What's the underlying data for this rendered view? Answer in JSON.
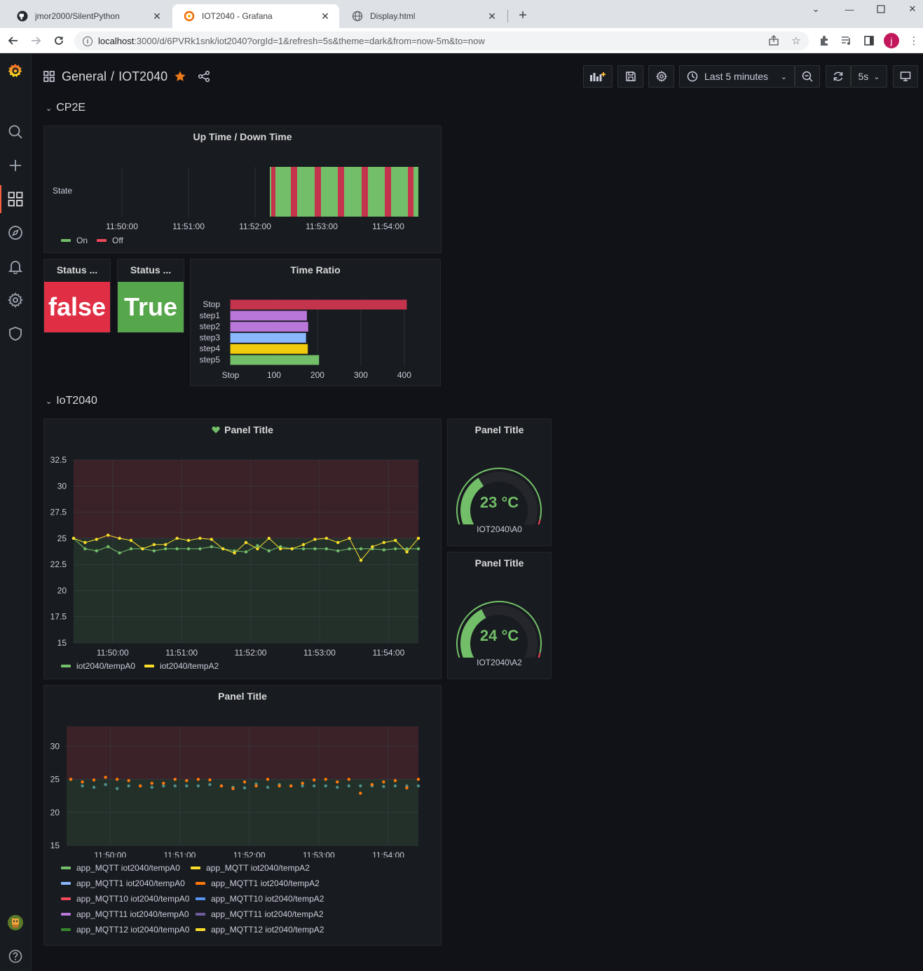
{
  "browser": {
    "tabs": [
      {
        "title": "jmor2000/SilentPython",
        "icon": "github-icon",
        "active": false
      },
      {
        "title": "IOT2040 - Grafana",
        "icon": "grafana-icon",
        "active": true
      },
      {
        "title": "Display.html",
        "icon": "globe-icon",
        "active": false
      }
    ],
    "url_host": "localhost",
    "url_rest": ":3000/d/6PVRk1snk/iot2040?orgId=1&refresh=5s&theme=dark&from=now-5m&to=now",
    "profile_initial": "j"
  },
  "header": {
    "folder": "General",
    "separator": "/",
    "dashboard": "IOT2040",
    "time_range": "Last 5 minutes",
    "refresh": "5s"
  },
  "rows": {
    "cp2e": "CP2E",
    "iot2040": "IoT2040"
  },
  "colors": {
    "green": "#73bf69",
    "red": "#c4344d",
    "yellow": "#fade2a",
    "orange": "#ff780a",
    "stat_red": "#e02f44",
    "stat_green": "#56a64b"
  },
  "panels": {
    "uptime": {
      "title": "Up Time / Down Time",
      "row_label": "State",
      "ticks": [
        "11:50:00",
        "11:51:00",
        "11:52:00",
        "11:53:00",
        "11:54:00"
      ],
      "legend": [
        {
          "name": "On",
          "color": "#73bf69"
        },
        {
          "name": "Off",
          "color": "#f2495c"
        }
      ]
    },
    "status1": {
      "title": "Status ...",
      "value": "false"
    },
    "status2": {
      "title": "Status ...",
      "value": "True"
    },
    "time_ratio": {
      "title": "Time Ratio"
    },
    "temp_panel": {
      "title": "Panel Title",
      "yticks": [
        "32.5",
        "30",
        "27.5",
        "25",
        "22.5",
        "20",
        "17.5",
        "15"
      ],
      "xticks": [
        "11:50:00",
        "11:51:00",
        "11:52:00",
        "11:53:00",
        "11:54:00"
      ],
      "legend": [
        {
          "name": "iot2040/tempA0",
          "color": "#73bf69"
        },
        {
          "name": "iot2040/tempA2",
          "color": "#fade2a"
        }
      ]
    },
    "gauge_a0": {
      "title": "Panel Title",
      "value": "23 °C",
      "label": "IOT2040\\A0",
      "fraction": 0.38
    },
    "gauge_a2": {
      "title": "Panel Title",
      "value": "24 °C",
      "label": "IOT2040\\A2",
      "fraction": 0.4
    },
    "mqtt_panel": {
      "title": "Panel Title",
      "yticks": [
        "30",
        "25",
        "20",
        "15"
      ],
      "xticks": [
        "11:50:00",
        "11:51:00",
        "11:52:00",
        "11:53:00",
        "11:54:00"
      ],
      "legend": [
        {
          "name": "app_MQTT iot2040/tempA0",
          "color": "#73bf69"
        },
        {
          "name": "app_MQTT iot2040/tempA2",
          "color": "#fade2a"
        },
        {
          "name": "app_MQTT1 iot2040/tempA0",
          "color": "#8ab8ff"
        },
        {
          "name": "app_MQTT1 iot2040/tempA2",
          "color": "#ff780a"
        },
        {
          "name": "app_MQTT10 iot2040/tempA0",
          "color": "#f2495c"
        },
        {
          "name": "app_MQTT10 iot2040/tempA2",
          "color": "#5794f2"
        },
        {
          "name": "app_MQTT11 iot2040/tempA0",
          "color": "#b877d9"
        },
        {
          "name": "app_MQTT11 iot2040/tempA2",
          "color": "#705da0"
        },
        {
          "name": "app_MQTT12 iot2040/tempA0",
          "color": "#37872d"
        },
        {
          "name": "app_MQTT12 iot2040/tempA2",
          "color": "#fade2a"
        }
      ]
    }
  },
  "chart_data": [
    {
      "type": "bar",
      "title": "Time Ratio",
      "orientation": "horizontal",
      "categories": [
        "Stop",
        "step1",
        "step2",
        "step3",
        "step4",
        "step5"
      ],
      "values": [
        405,
        175,
        178,
        173,
        177,
        203
      ],
      "colors": [
        "#c4344d",
        "#b877d9",
        "#b877d9",
        "#8ab8ff",
        "#f2cc0c",
        "#73bf69"
      ],
      "xticks": [
        "Stop",
        "100",
        "200",
        "300",
        "400"
      ],
      "xlim": [
        0,
        420
      ]
    },
    {
      "type": "line",
      "title": "Panel Title",
      "ylim": [
        15,
        32.5
      ],
      "x": [
        "11:49:26",
        "11:49:36",
        "11:49:46",
        "11:49:56",
        "11:50:06",
        "11:50:16",
        "11:50:26",
        "11:50:36",
        "11:50:46",
        "11:50:56",
        "11:51:06",
        "11:51:16",
        "11:51:26",
        "11:51:36",
        "11:51:46",
        "11:51:56",
        "11:52:06",
        "11:52:16",
        "11:52:26",
        "11:52:36",
        "11:52:46",
        "11:52:56",
        "11:53:06",
        "11:53:16",
        "11:53:26",
        "11:53:36",
        "11:53:46",
        "11:53:56",
        "11:54:06",
        "11:54:16",
        "11:54:26"
      ],
      "series": [
        {
          "name": "iot2040/tempA0",
          "values": [
            25,
            24,
            23.8,
            24.2,
            23.6,
            24,
            24,
            23.8,
            24,
            24,
            24,
            24,
            24.2,
            24,
            23.8,
            23.7,
            24.3,
            23.8,
            24.2,
            24,
            24,
            24,
            24,
            23.8,
            24,
            24,
            24,
            23.9,
            24,
            24,
            24
          ]
        },
        {
          "name": "iot2040/tempA2",
          "values": [
            25,
            24.6,
            24.9,
            25.3,
            25,
            24.8,
            24,
            24.4,
            24.4,
            25,
            24.8,
            25,
            24.9,
            24,
            23.6,
            24.6,
            24,
            25,
            24,
            24,
            24.4,
            24.9,
            25,
            24.6,
            25,
            22.9,
            24.2,
            24.6,
            24.8,
            23.7,
            25
          ]
        }
      ]
    },
    {
      "type": "scatter",
      "title": "Panel Title",
      "ylim": [
        15,
        33
      ],
      "x": [
        "11:49:26",
        "11:49:36",
        "11:49:46",
        "11:49:56",
        "11:50:06",
        "11:50:16",
        "11:50:26",
        "11:50:36",
        "11:50:46",
        "11:50:56",
        "11:51:06",
        "11:51:16",
        "11:51:26",
        "11:51:36",
        "11:51:46",
        "11:51:56",
        "11:52:06",
        "11:52:16",
        "11:52:26",
        "11:52:36",
        "11:52:46",
        "11:52:56",
        "11:53:06",
        "11:53:16",
        "11:53:26",
        "11:53:36",
        "11:53:46",
        "11:53:56",
        "11:54:06",
        "11:54:16",
        "11:54:26"
      ],
      "series": [
        {
          "name": "app_MQTT iot2040/tempA0",
          "values": [
            25,
            24,
            23.8,
            24.2,
            23.6,
            24,
            24,
            23.8,
            24,
            24,
            24,
            24,
            24.2,
            24,
            23.8,
            23.7,
            24.3,
            23.8,
            24.2,
            24,
            24,
            24,
            24,
            23.8,
            24,
            24,
            24,
            23.9,
            24,
            24,
            24
          ]
        },
        {
          "name": "app_MQTT1 iot2040/tempA2",
          "values": [
            25,
            24.6,
            24.9,
            25.3,
            25,
            24.8,
            24,
            24.4,
            24.4,
            25,
            24.8,
            25,
            24.9,
            24,
            23.6,
            24.6,
            24,
            25,
            24,
            24,
            24.4,
            24.9,
            25,
            24.6,
            25,
            22.9,
            24.2,
            24.6,
            24.8,
            23.7,
            25
          ]
        }
      ]
    }
  ]
}
